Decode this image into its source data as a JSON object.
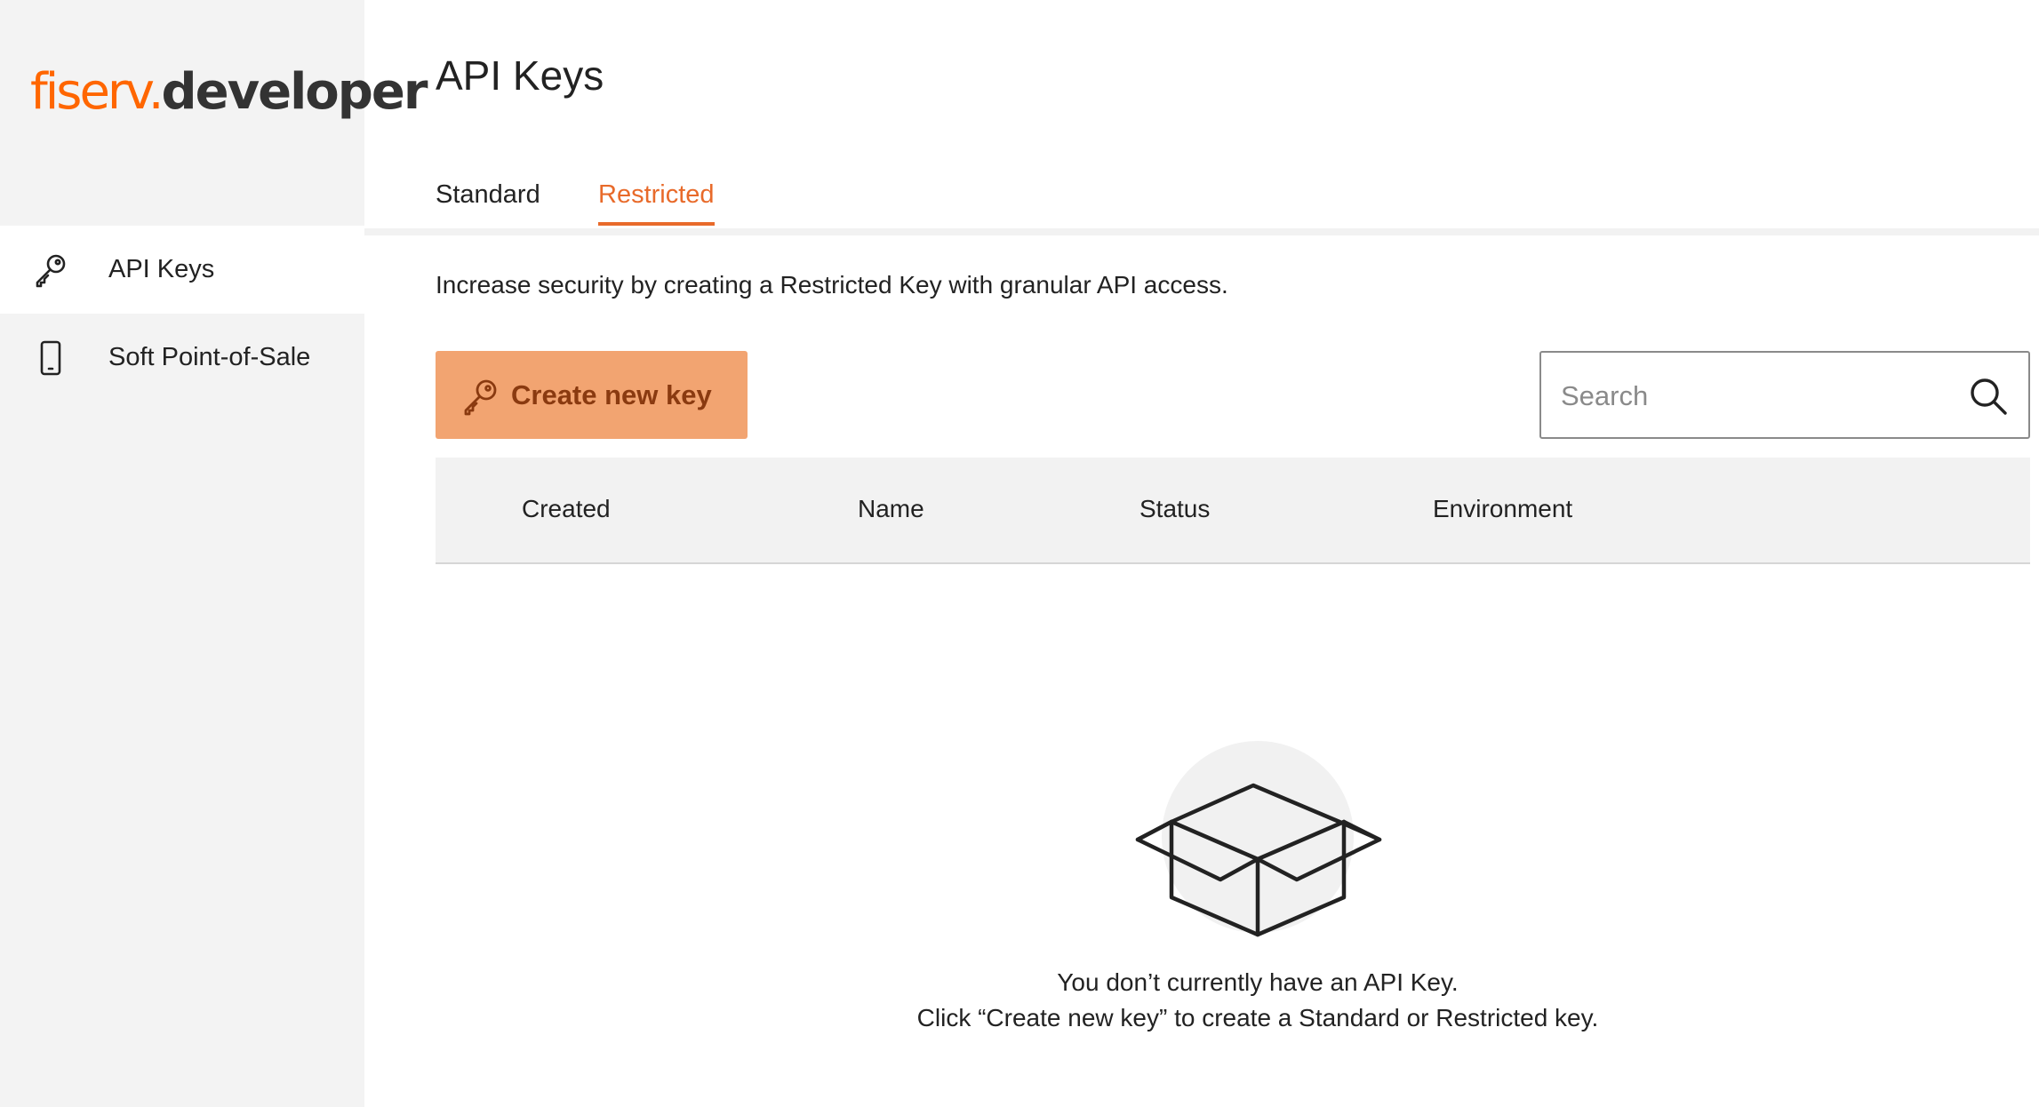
{
  "brand": {
    "logo_main": "fiserv.",
    "logo_sub": "developer",
    "accent": "#ff6600"
  },
  "sidebar": {
    "items": [
      {
        "label": "API Keys",
        "icon": "key-icon",
        "active": true
      },
      {
        "label": "Soft Point-of-Sale",
        "icon": "phone-icon",
        "active": false
      }
    ]
  },
  "page": {
    "title": "API Keys",
    "tabs": [
      {
        "label": "Standard",
        "active": false
      },
      {
        "label": "Restricted",
        "active": true
      }
    ],
    "description": "Increase security by creating a Restricted Key with granular API access.",
    "create_button": {
      "label": "Create new key",
      "icon": "key-icon",
      "color": "#f2a471"
    },
    "search": {
      "placeholder": "Search",
      "value": "",
      "icon": "search-icon"
    },
    "table": {
      "columns": [
        "Created",
        "Name",
        "Status",
        "Environment"
      ],
      "rows": []
    },
    "empty_state": {
      "icon": "open-box-icon",
      "line1": "You don’t currently have an API Key.",
      "line2": "Click “Create new key” to create a Standard or Restricted key."
    }
  },
  "colors": {
    "tab_active": "#e86a2a",
    "sidebar_bg": "#f3f3f3",
    "table_header_bg": "#f2f2f2"
  }
}
